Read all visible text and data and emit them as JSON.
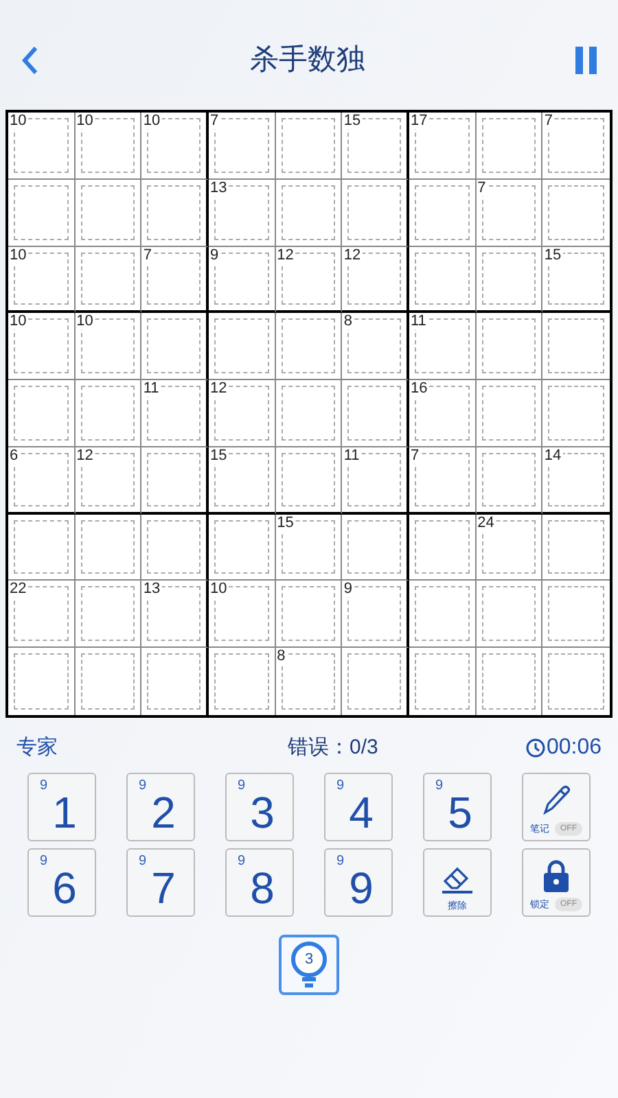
{
  "header": {
    "title": "杀手数独"
  },
  "grid": {
    "rows": [
      [
        {
          "sum": "10"
        },
        {
          "sum": "10"
        },
        {
          "sum": "10"
        },
        {
          "sum": "7"
        },
        {},
        {
          "sum": "15"
        },
        {
          "sum": "17"
        },
        {},
        {
          "sum": "7"
        }
      ],
      [
        {},
        {},
        {},
        {
          "sum": "13"
        },
        {},
        {},
        {},
        {
          "sum": "7"
        },
        {}
      ],
      [
        {
          "sum": "10"
        },
        {},
        {
          "sum": "7"
        },
        {
          "sum": "9"
        },
        {
          "sum": "12"
        },
        {
          "sum": "12"
        },
        {},
        {},
        {
          "sum": "15"
        }
      ],
      [
        {
          "sum": "10"
        },
        {
          "sum": "10"
        },
        {},
        {},
        {},
        {
          "sum": "8"
        },
        {
          "sum": "11"
        },
        {},
        {}
      ],
      [
        {},
        {},
        {
          "sum": "11"
        },
        {
          "sum": "12"
        },
        {},
        {},
        {
          "sum": "16"
        },
        {},
        {}
      ],
      [
        {
          "sum": "6"
        },
        {
          "sum": "12"
        },
        {},
        {
          "sum": "15"
        },
        {},
        {
          "sum": "11"
        },
        {
          "sum": "7"
        },
        {},
        {
          "sum": "14"
        }
      ],
      [
        {},
        {},
        {},
        {},
        {
          "sum": "15"
        },
        {},
        {},
        {
          "sum": "24"
        },
        {}
      ],
      [
        {
          "sum": "22"
        },
        {},
        {
          "sum": "13"
        },
        {
          "sum": "10"
        },
        {},
        {
          "sum": "9"
        },
        {},
        {},
        {}
      ],
      [
        {},
        {},
        {},
        {},
        {
          "sum": "8"
        },
        {},
        {},
        {},
        {}
      ]
    ]
  },
  "status": {
    "difficulty": "专家",
    "errors": "错误：0/3",
    "timer": "00:06"
  },
  "number_keys": [
    {
      "count": "9",
      "digit": "1"
    },
    {
      "count": "9",
      "digit": "2"
    },
    {
      "count": "9",
      "digit": "3"
    },
    {
      "count": "9",
      "digit": "4"
    },
    {
      "count": "9",
      "digit": "5"
    },
    {
      "count": "9",
      "digit": "6"
    },
    {
      "count": "9",
      "digit": "7"
    },
    {
      "count": "9",
      "digit": "8"
    },
    {
      "count": "9",
      "digit": "9"
    }
  ],
  "tools": [
    {
      "kind": "notes",
      "label": "笔记",
      "toggle": "OFF",
      "on": false
    },
    {
      "kind": "erase",
      "label": "擦除"
    },
    {
      "kind": "lock",
      "label": "锁定",
      "toggle": "OFF",
      "on": false
    }
  ],
  "hint": {
    "count": "3"
  }
}
